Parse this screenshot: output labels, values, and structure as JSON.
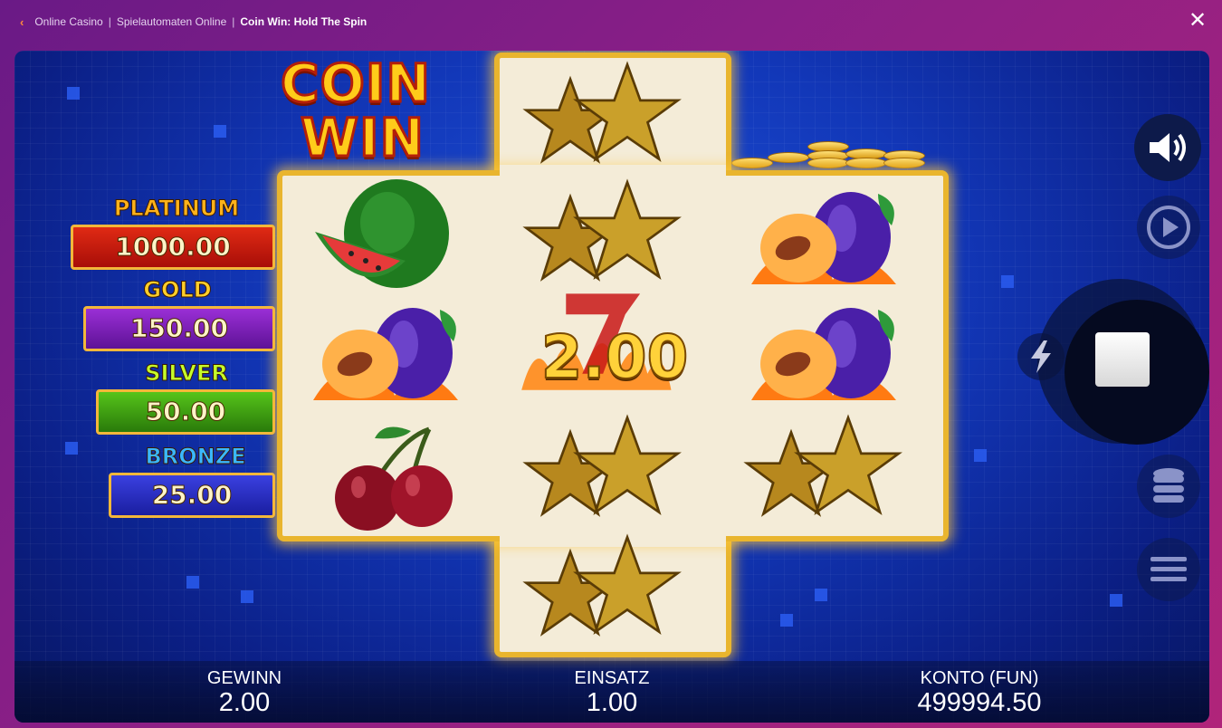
{
  "breadcrumb": {
    "back_icon": "chevron-left-icon",
    "items": [
      "Online Casino",
      "Spielautomaten Online",
      "Coin Win: Hold The Spin"
    ],
    "separator": "|"
  },
  "close_icon": "close-icon",
  "logo": {
    "line1": "COIN",
    "line2": "WIN"
  },
  "jackpots": [
    {
      "name": "PLATINUM",
      "value": "1000.00",
      "color": "#c8160e"
    },
    {
      "name": "GOLD",
      "value": "150.00",
      "color": "#7a1fb0"
    },
    {
      "name": "SILVER",
      "value": "50.00",
      "color": "#3f9a12"
    },
    {
      "name": "BRONZE",
      "value": "25.00",
      "color": "#2c2fc8"
    }
  ],
  "reels": {
    "col1": [
      "watermelon",
      "plum-fire",
      "cherry"
    ],
    "col2": [
      "star",
      "star",
      "seven-coin",
      "star",
      "star"
    ],
    "col3": [
      "plum-fire",
      "plum-fire",
      "star"
    ]
  },
  "coin_prize": "2.00",
  "controls": {
    "sound_icon": "speaker-icon",
    "autoplay_icon": "autoplay-icon",
    "turbo_icon": "lightning-icon",
    "spin_icon": "stop-icon",
    "bet_icon": "coin-stack-icon",
    "menu_icon": "hamburger-menu-icon"
  },
  "bottom": {
    "win_label": "GEWINN",
    "win_value": "2.00",
    "bet_label": "EINSATZ",
    "bet_value": "1.00",
    "balance_label": "KONTO (FUN)",
    "balance_value": "499994.50"
  }
}
